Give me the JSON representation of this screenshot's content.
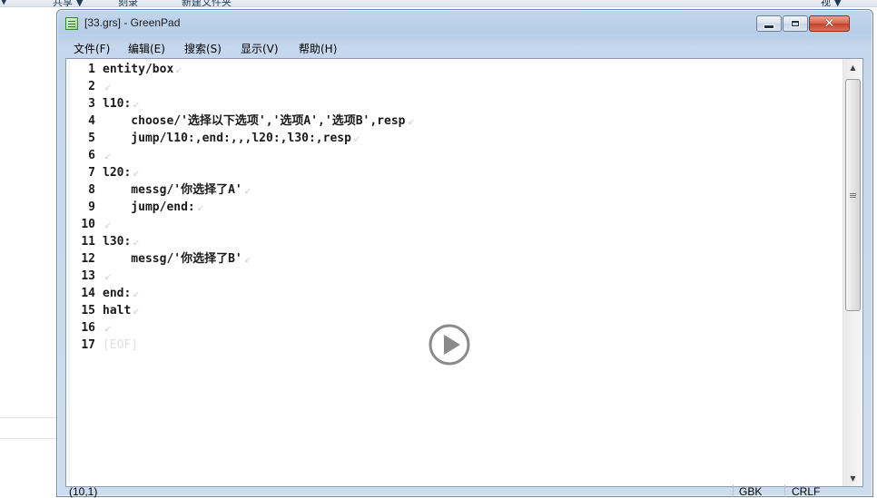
{
  "background": {
    "top_items": [
      "共享 ▼",
      "刻录",
      "新建文件夹",
      "视 ▼"
    ]
  },
  "window": {
    "title": "[33.grs] - GreenPad",
    "icon": "greenpad-icon"
  },
  "menu": [
    {
      "label": "文件(F)"
    },
    {
      "label": "编辑(E)"
    },
    {
      "label": "搜索(S)"
    },
    {
      "label": "显示(V)"
    },
    {
      "label": "帮助(H)"
    }
  ],
  "editor": {
    "lines": [
      {
        "num": "1",
        "text": "entity/box",
        "eol": "↙"
      },
      {
        "num": "2",
        "text": "",
        "eol": "↙"
      },
      {
        "num": "3",
        "text": "l10:",
        "eol": "↙"
      },
      {
        "num": "4",
        "text": "    choose/'选择以下选项','选项A','选项B',resp",
        "eol": "↙"
      },
      {
        "num": "5",
        "text": "    jump/l10:,end:,,,l20:,l30:,resp",
        "eol": "↙"
      },
      {
        "num": "6",
        "text": "",
        "eol": "↙"
      },
      {
        "num": "7",
        "text": "l20:",
        "eol": "↙"
      },
      {
        "num": "8",
        "text": "    messg/'你选择了A'",
        "eol": "↙"
      },
      {
        "num": "9",
        "text": "    jump/end:",
        "eol": "↙"
      },
      {
        "num": "10",
        "text": "",
        "eol": "↙"
      },
      {
        "num": "11",
        "text": "l30:",
        "eol": "↙"
      },
      {
        "num": "12",
        "text": "    messg/'你选择了B'",
        "eol": "↙"
      },
      {
        "num": "13",
        "text": "",
        "eol": "↙"
      },
      {
        "num": "14",
        "text": "end:",
        "eol": "↙"
      },
      {
        "num": "15",
        "text": "halt",
        "eol": "↙"
      },
      {
        "num": "16",
        "text": "",
        "eol": "↙"
      },
      {
        "num": "17",
        "text": "[EOF]",
        "eol": "",
        "is_eof": true
      }
    ]
  },
  "status": {
    "position": "(10,1)",
    "encoding": "GBK",
    "line_ending": "CRLF"
  }
}
